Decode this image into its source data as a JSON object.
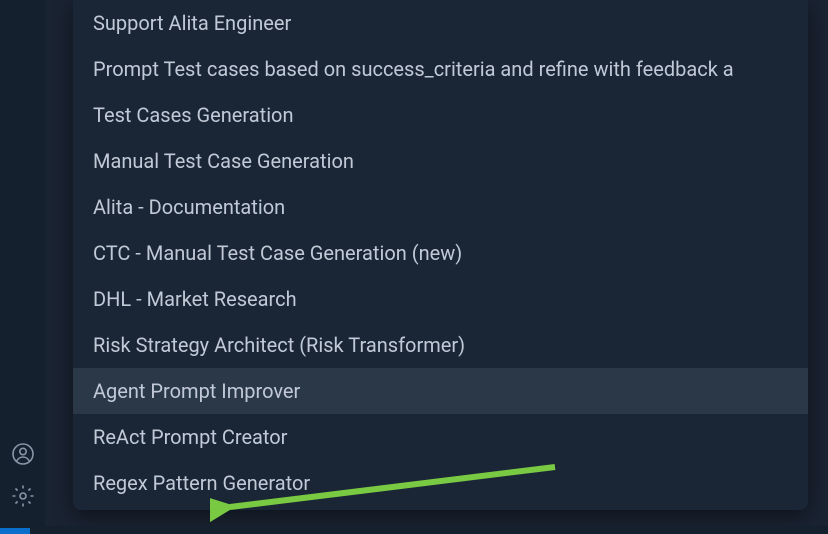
{
  "dropdown": {
    "items": [
      {
        "label": "Support Alita Engineer",
        "highlighted": false
      },
      {
        "label": "Prompt Test cases based on success_criteria and refine with feedback a",
        "highlighted": false
      },
      {
        "label": "Test Cases Generation",
        "highlighted": false
      },
      {
        "label": "Manual Test Case Generation",
        "highlighted": false
      },
      {
        "label": "Alita - Documentation",
        "highlighted": false
      },
      {
        "label": "CTC - Manual Test Case Generation (new)",
        "highlighted": false
      },
      {
        "label": "DHL - Market Research",
        "highlighted": false
      },
      {
        "label": "Risk Strategy Architect (Risk Transformer)",
        "highlighted": false
      },
      {
        "label": "Agent Prompt Improver",
        "highlighted": true
      },
      {
        "label": "ReAct Prompt Creator",
        "highlighted": false
      },
      {
        "label": "Regex Pattern Generator",
        "highlighted": false
      }
    ]
  },
  "annotation": {
    "arrow_color": "#7ac943"
  }
}
